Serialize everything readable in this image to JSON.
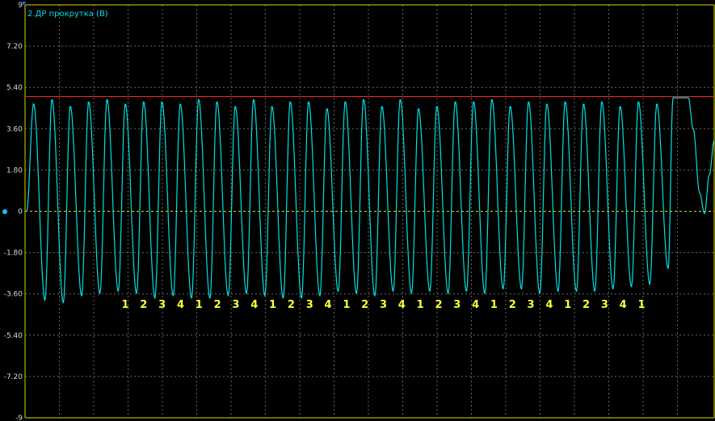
{
  "chart_data": {
    "type": "line",
    "title": "2.ДР прокрутка (В)",
    "ylim": [
      -9,
      9
    ],
    "yticks": [
      9,
      7.2,
      5.4,
      3.6,
      1.8,
      0,
      -1.8,
      -3.6,
      -5.4,
      -7.2,
      -9
    ],
    "ytick_labels": [
      "9",
      "7.20",
      "5.40",
      "3.60",
      "1.80",
      "0",
      "-1.80",
      "-3.60",
      "-5.40",
      "-7.20",
      "-9"
    ],
    "threshold": 5.0,
    "grid": true,
    "colors": {
      "background": "#000000",
      "trace": "#00e0e0",
      "threshold": "#ff2020",
      "zero_line": "#d8d800",
      "frame": "#d8d800",
      "grid": "#666666",
      "markers": "#ffff33"
    },
    "series": [
      {
        "waveform": "oscillation",
        "cycles": 35,
        "peaks": [
          4.7,
          4.9,
          4.6,
          4.8,
          4.9,
          4.7,
          4.8,
          4.8,
          4.7,
          4.9,
          4.8,
          4.6,
          4.9,
          4.6,
          4.8,
          4.8,
          4.5,
          4.8,
          4.9,
          4.6,
          4.9,
          4.5,
          4.6,
          4.8,
          4.8,
          4.9,
          4.6,
          4.8,
          4.7,
          4.8,
          4.7,
          4.8,
          4.6,
          4.8,
          4.7
        ],
        "troughs": [
          -3.9,
          -4.0,
          -3.7,
          -3.6,
          -3.5,
          -3.6,
          -3.8,
          -3.7,
          -3.8,
          -3.8,
          -3.7,
          -3.6,
          -3.7,
          -3.8,
          -3.8,
          -3.7,
          -3.5,
          -3.6,
          -3.7,
          -3.5,
          -3.6,
          -3.5,
          -3.6,
          -3.5,
          -3.6,
          -3.4,
          -3.4,
          -3.6,
          -3.5,
          -3.5,
          -3.5,
          -3.4,
          -3.3,
          -3.2,
          -2.5
        ],
        "end_plateau": 4.95,
        "end_dip": -0.1,
        "end_value": 3.1
      }
    ],
    "annotations": [
      "1",
      "2",
      "3",
      "4",
      "1",
      "2",
      "3",
      "4",
      "1",
      "2",
      "3",
      "4",
      "1",
      "2",
      "3",
      "4",
      "1",
      "2",
      "3",
      "4",
      "1",
      "2",
      "3",
      "4",
      "1",
      "2",
      "3",
      "4",
      "1"
    ]
  }
}
